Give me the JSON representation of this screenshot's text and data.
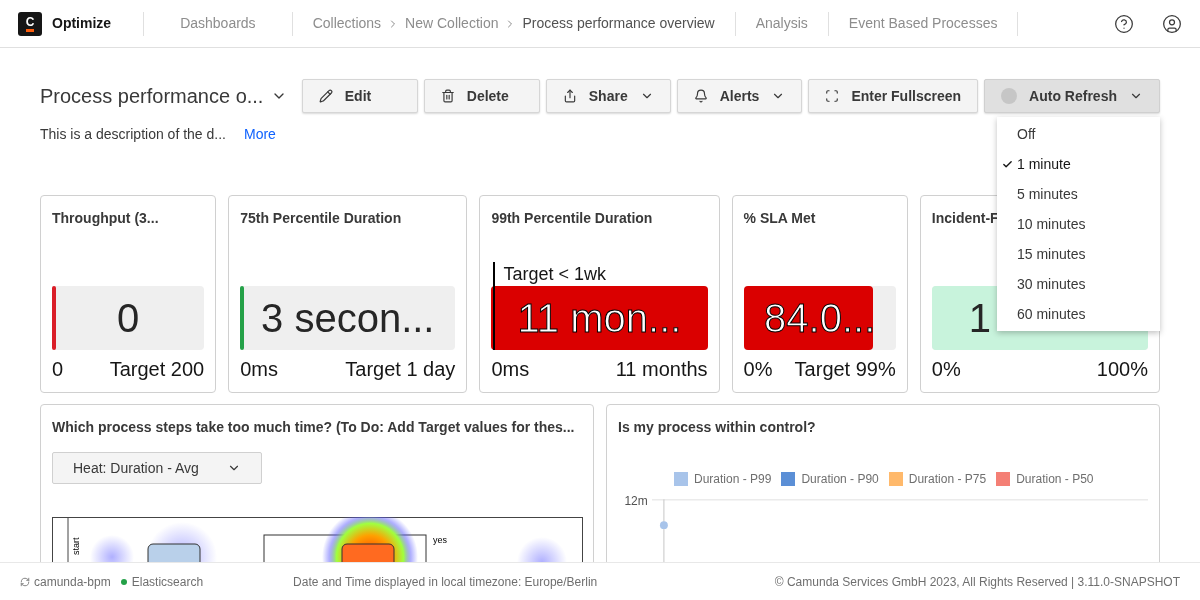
{
  "header": {
    "logo_letter": "C",
    "brand": "Optimize",
    "nav": [
      {
        "label": "Dashboards"
      }
    ],
    "breadcrumbs": [
      {
        "label": "Collections",
        "current": false
      },
      {
        "label": "New Collection",
        "current": false
      },
      {
        "label": "Process performance overview",
        "current": true
      }
    ],
    "nav_right": [
      {
        "label": "Analysis"
      },
      {
        "label": "Event Based Processes"
      }
    ]
  },
  "dashboard": {
    "title": "Process performance o...",
    "description": "This is a description of the d...",
    "more_link": "More",
    "buttons": [
      {
        "label": "Edit",
        "has_menu": false,
        "open": false
      },
      {
        "label": "Delete",
        "has_menu": false,
        "open": false
      },
      {
        "label": "Share",
        "has_menu": true,
        "open": false
      },
      {
        "label": "Alerts",
        "has_menu": true,
        "open": false
      },
      {
        "label": "Enter Fullscreen",
        "has_menu": false,
        "open": false
      },
      {
        "label": "Auto Refresh",
        "has_menu": true,
        "open": true
      }
    ],
    "refresh_menu": [
      {
        "label": "Off",
        "selected": false
      },
      {
        "label": "1 minute",
        "selected": true
      },
      {
        "label": "5 minutes",
        "selected": false
      },
      {
        "label": "10 minutes",
        "selected": false
      },
      {
        "label": "15 minutes",
        "selected": false
      },
      {
        "label": "30 minutes",
        "selected": false
      },
      {
        "label": "60 minutes",
        "selected": false
      }
    ]
  },
  "kpis": [
    {
      "title": "Throughput (3...",
      "value": "0",
      "min": "0",
      "target": "Target 200",
      "level": 0,
      "color": "#da1e28"
    },
    {
      "title": "75th Percentile Duration",
      "value": "3 secon...",
      "min": "0ms",
      "target": "Target 1 day",
      "level": 0,
      "color": "#24a148"
    },
    {
      "title": "99th Percentile Duration",
      "goal": "Target < 1wk",
      "value": "11 mon...",
      "min": "0ms",
      "target": "11 months",
      "level": 1,
      "color": "#da0000"
    },
    {
      "title": "% SLA Met",
      "value": "84.0...",
      "min": "0%",
      "target": "Target 99%",
      "level": 0.85,
      "color": "#da0000"
    },
    {
      "title": "Incident-F",
      "value": "1",
      "min": "0%",
      "target": "100%",
      "level": 1,
      "color": "#c8f3dc"
    }
  ],
  "heatmap_panel": {
    "title": "Which process steps take too much time? (To Do: Add Target values for thes...",
    "select": "Heat: Duration - Avg",
    "diagram_labels": [
      "start",
      "yes"
    ]
  },
  "chart_panel": {
    "title": "Is my process within control?",
    "legend": [
      {
        "label": "Duration - P99",
        "color": "#a8c4ea"
      },
      {
        "label": "Duration - P90",
        "color": "#5b8fd6"
      },
      {
        "label": "Duration - P75",
        "color": "#ffb96b"
      },
      {
        "label": "Duration - P50",
        "color": "#f47f75"
      }
    ],
    "y_tick": "12m"
  },
  "footer": {
    "engine": "camunda-bpm",
    "database": {
      "label": "Elasticsearch",
      "color": "#24a148"
    },
    "timezone": "Date and Time displayed in local timezone: Europe/Berlin",
    "copyright": "© Camunda Services GmbH 2023, All Rights Reserved | 3.11.0-SNAPSHOT"
  }
}
